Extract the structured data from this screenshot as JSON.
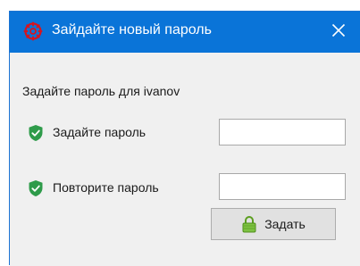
{
  "window": {
    "title": "Зайдайте новый пароль",
    "app_icon": "app-gear-icon",
    "close_icon": "close-icon",
    "accent_color": "#0a74d8"
  },
  "dialog": {
    "subtitle": "Задайте пароль для ivanov",
    "fields": [
      {
        "label": "Задайте пароль",
        "icon": "shield-icon",
        "value": "",
        "placeholder": ""
      },
      {
        "label": "Повторите пароль",
        "icon": "shield-icon",
        "value": "",
        "placeholder": ""
      }
    ],
    "submit_label": "Задать",
    "submit_icon": "lock-icon"
  }
}
